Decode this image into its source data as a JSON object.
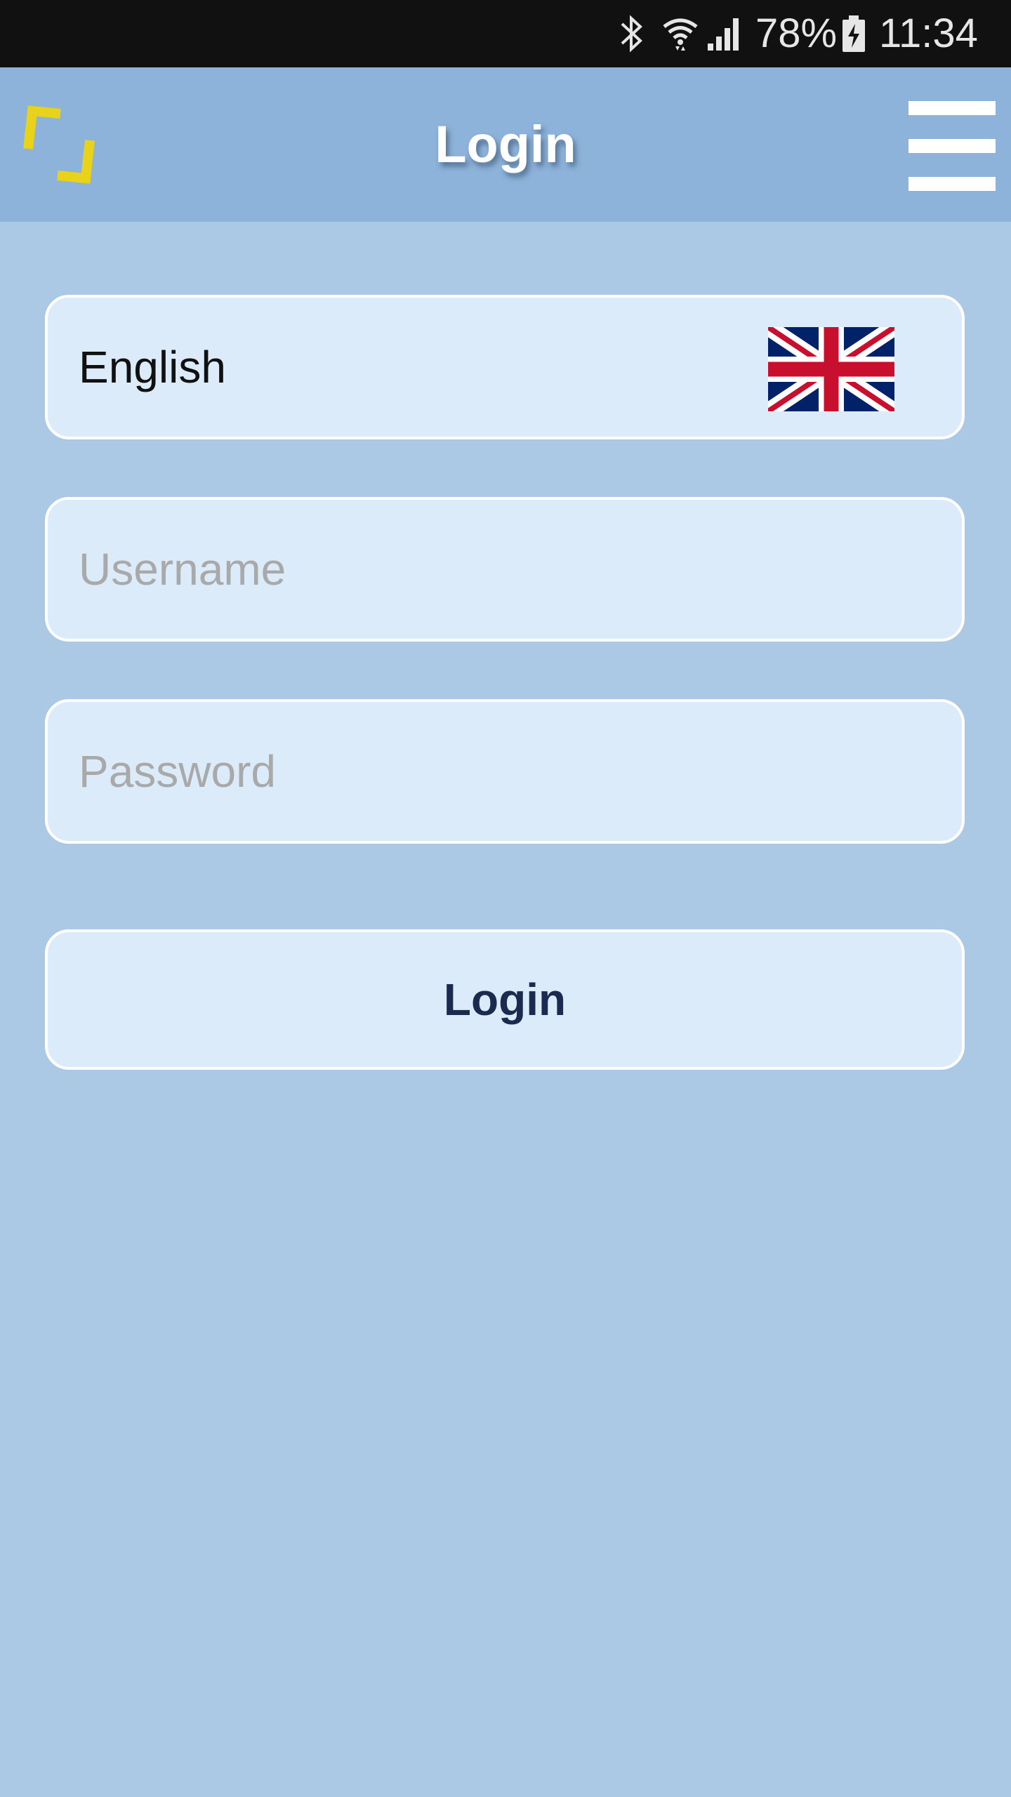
{
  "status_bar": {
    "battery_percent": "78%",
    "time": "11:34",
    "icons": [
      "bluetooth-icon",
      "wifi-icon",
      "signal-icon",
      "battery-charging-icon"
    ]
  },
  "header": {
    "title": "Login",
    "logo_icon": "app-logo-icon",
    "menu_icon": "hamburger-menu-icon"
  },
  "form": {
    "language": {
      "label": "English",
      "flag_icon": "uk-flag-icon"
    },
    "username": {
      "placeholder": "Username",
      "value": ""
    },
    "password": {
      "placeholder": "Password",
      "value": ""
    },
    "login_button_label": "Login"
  },
  "colors": {
    "background": "#abc8e5",
    "header": "#8db3da",
    "field_fill": "#dcebfa",
    "logo_yellow": "#e8d21a",
    "button_text": "#1b2b4f"
  }
}
